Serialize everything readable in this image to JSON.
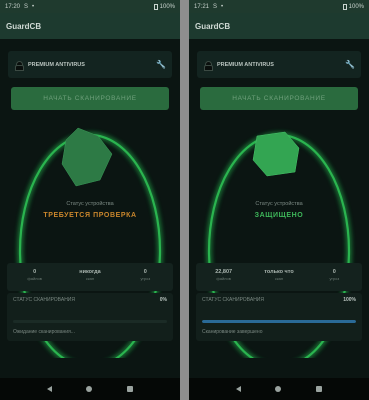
{
  "left": {
    "time": "17:20",
    "battery_text": "100%",
    "app_title": "GuardCB",
    "card_title": "PREMIUM ANTIVIRUS",
    "scan_button": "НАЧАТЬ СКАНИРОВАНИЕ",
    "device_status_label": "Статус устройства",
    "device_status_value": "ТРЕБУЕТСЯ ПРОВЕРКА",
    "stats": [
      {
        "value": "0",
        "label": "файлов"
      },
      {
        "value": "никогда",
        "label": "скан"
      },
      {
        "value": "0",
        "label": "угроз"
      }
    ],
    "scan_status_label": "СТАТУС СКАНИРОВАНИЯ",
    "scan_percent": "0%",
    "progress": 0,
    "scan_message": "Ожидание сканирования..."
  },
  "right": {
    "time": "17:21",
    "battery_text": "100%",
    "app_title": "GuardCB",
    "card_title": "PREMIUM ANTIVIRUS",
    "scan_button": "НАЧАТЬ СКАНИРОВАНИЕ",
    "device_status_label": "Статус устройства",
    "device_status_value": "ЗАЩИЩЕНО",
    "stats": [
      {
        "value": "22,807",
        "label": "файлов"
      },
      {
        "value": "только что",
        "label": "скан"
      },
      {
        "value": "0",
        "label": "угроз"
      }
    ],
    "scan_status_label": "СТАТУС СКАНИРОВАНИЯ",
    "scan_percent": "100%",
    "progress": 1,
    "scan_message": "Сканирование завершено"
  },
  "colors": {
    "accent_green": "#2ecc5a",
    "warning": "#c9862c",
    "progress_blue": "#2a6a97"
  }
}
